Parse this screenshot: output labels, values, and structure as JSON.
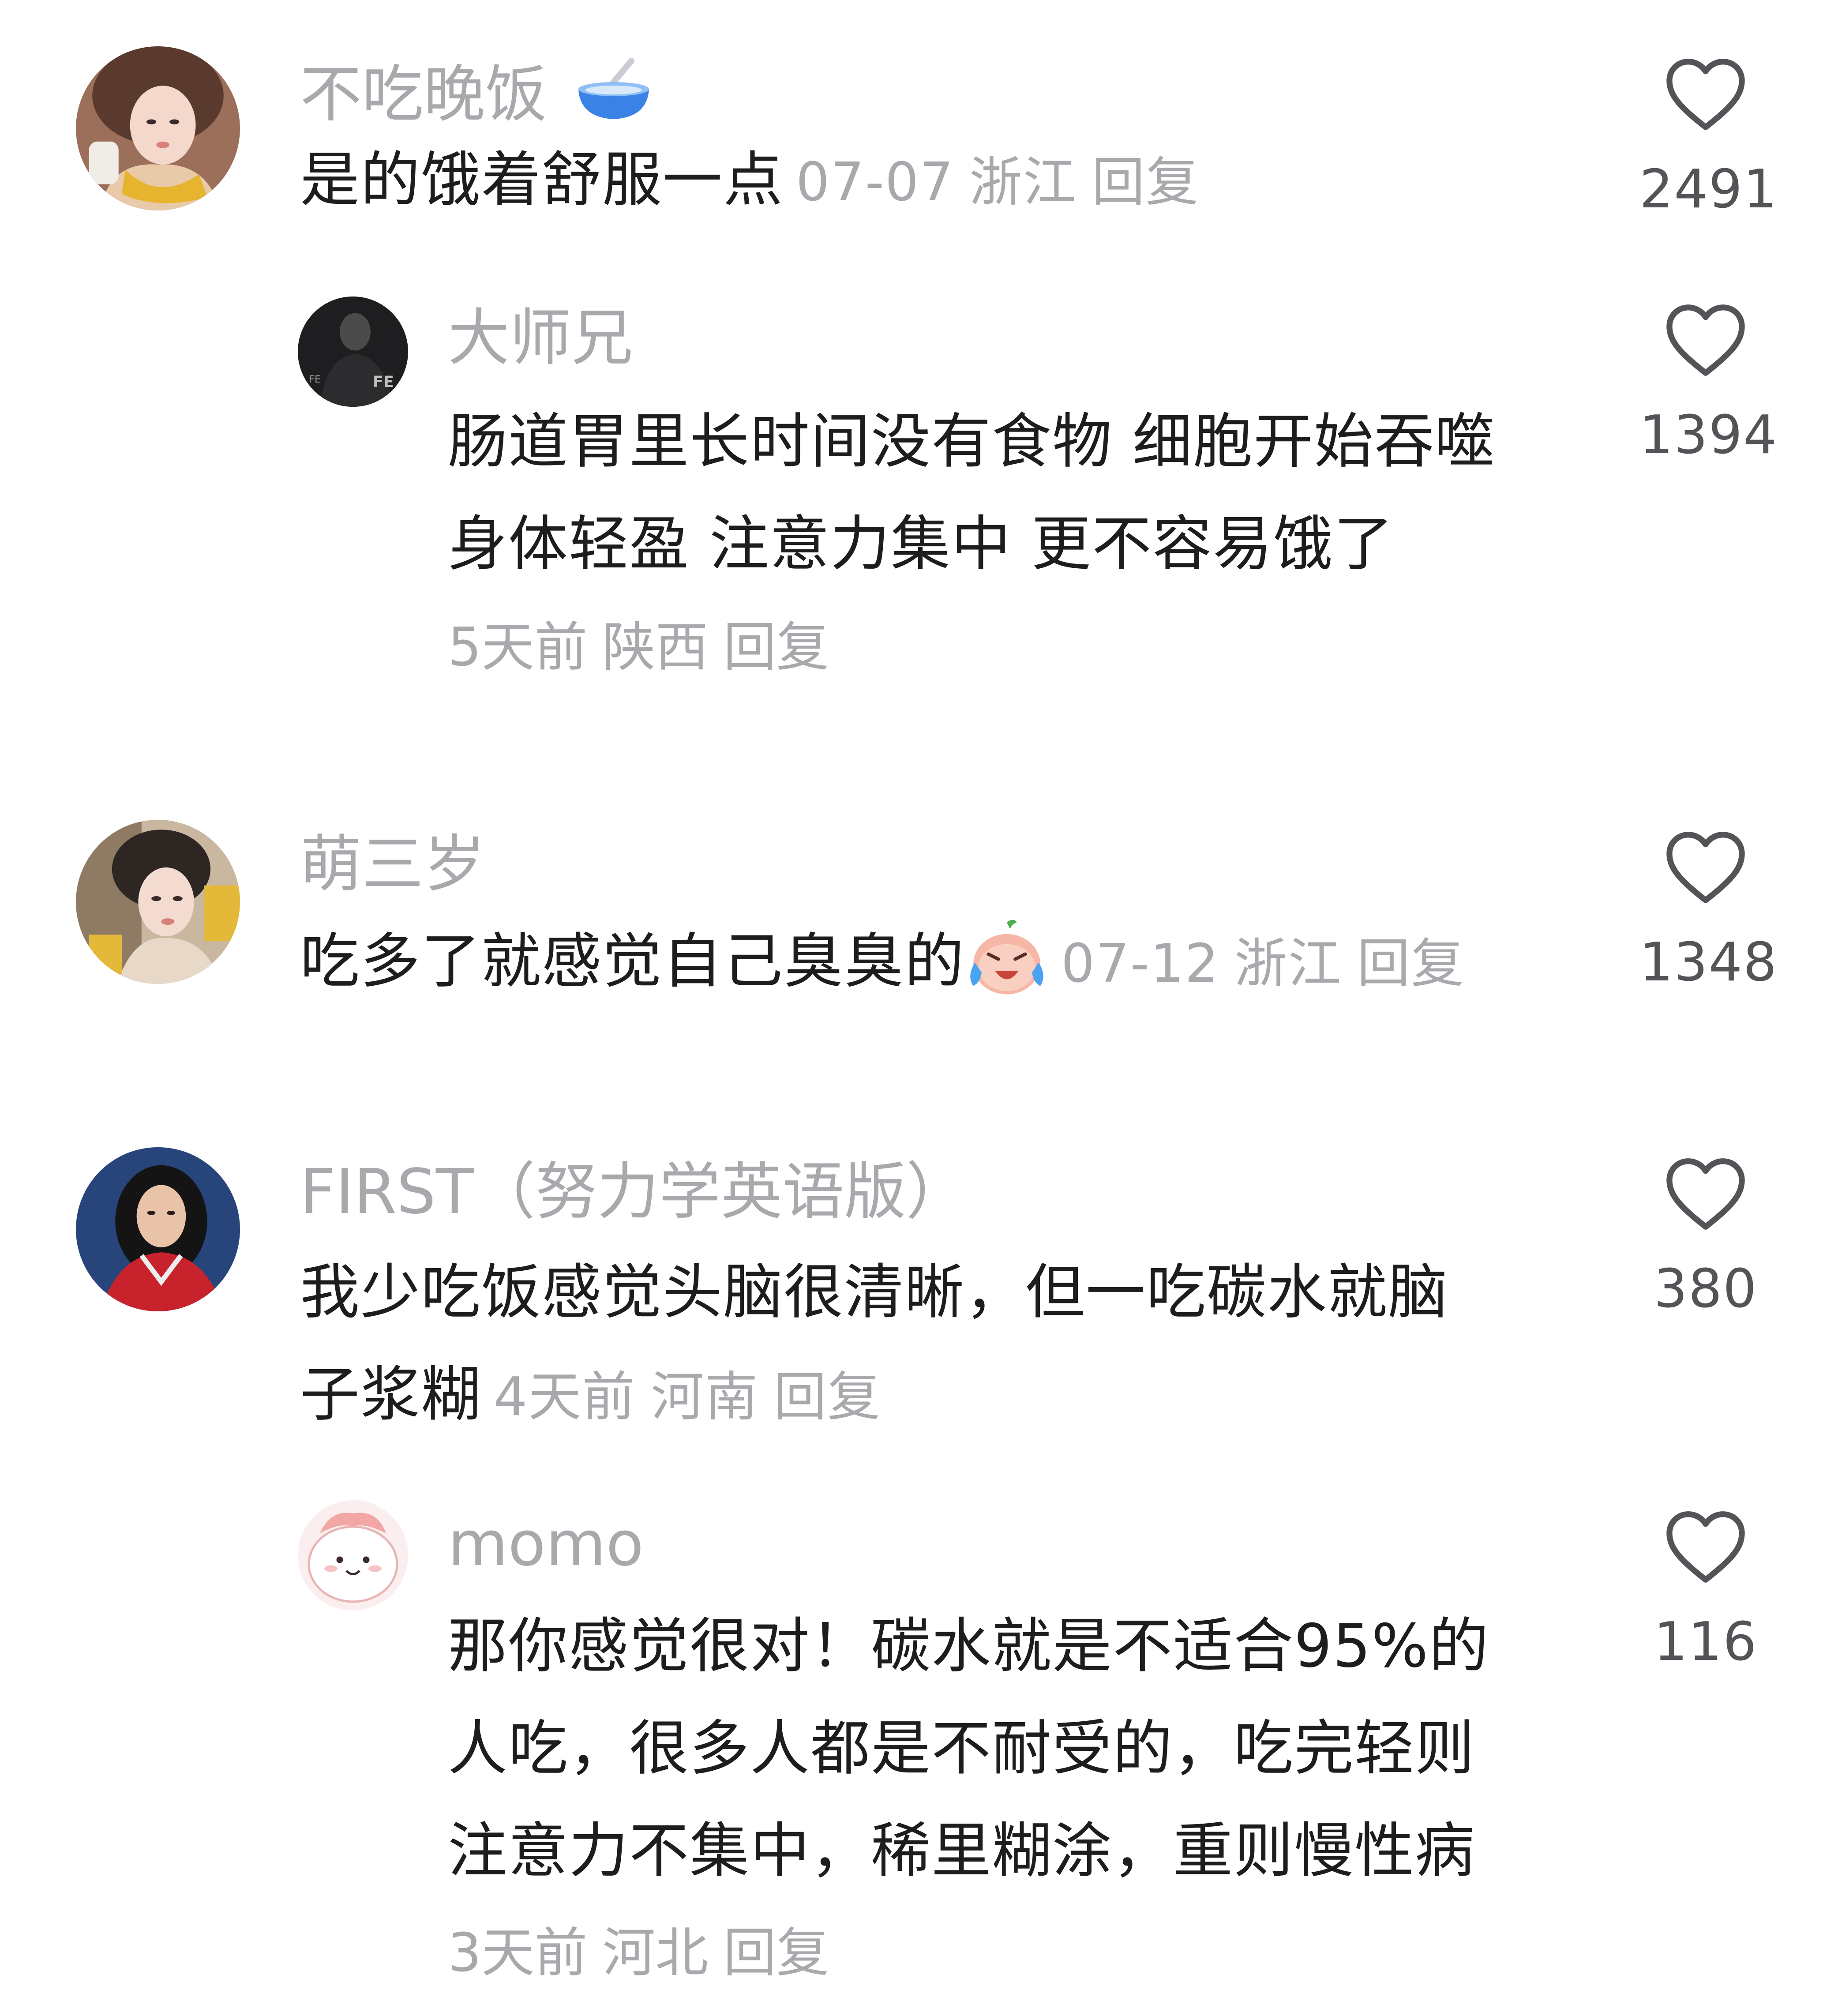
{
  "comments": [
    {
      "username": "不吃晚饭",
      "username_emoji": "bowl-spoon-emoji",
      "text": "是的饿着舒服一点",
      "date": "07-07",
      "location": "浙江",
      "reply": "回复",
      "likes": "2491"
    },
    {
      "username": "大师兄",
      "text_lines": [
        "肠道胃里长时间没有食物 细胞开始吞噬",
        "身体轻盈 注意力集中 更不容易饿了"
      ],
      "date": "5天前",
      "location": "陕西",
      "reply": "回复",
      "likes": "1394"
    },
    {
      "username": "萌三岁",
      "text": "吃多了就感觉自己臭臭的",
      "text_emoji": "crying-face-emoji",
      "date": "07-12",
      "location": "浙江",
      "reply": "回复",
      "likes": "1348"
    },
    {
      "username": "FIRST（努力学英语版）",
      "text_lines": [
        "我少吃饭感觉头脑很清晰，但一吃碳水就脑",
        "子浆糊"
      ],
      "date": "4天前",
      "location": "河南",
      "reply": "回复",
      "likes": "380"
    },
    {
      "username": "momo",
      "text_lines": [
        "那你感觉很对！碳水就是不适合95%的",
        "人吃，很多人都是不耐受的，吃完轻则",
        "注意力不集中，稀里糊涂，重则慢性病"
      ],
      "date": "3天前",
      "location": "河北",
      "reply": "回复",
      "likes": "116"
    }
  ],
  "colors": {
    "text": "#1d1d1f",
    "meta": "#a9a9ad",
    "like_icon": "#545458",
    "background": "#ffffff"
  },
  "icons": {
    "like": "heart-outline-icon"
  }
}
